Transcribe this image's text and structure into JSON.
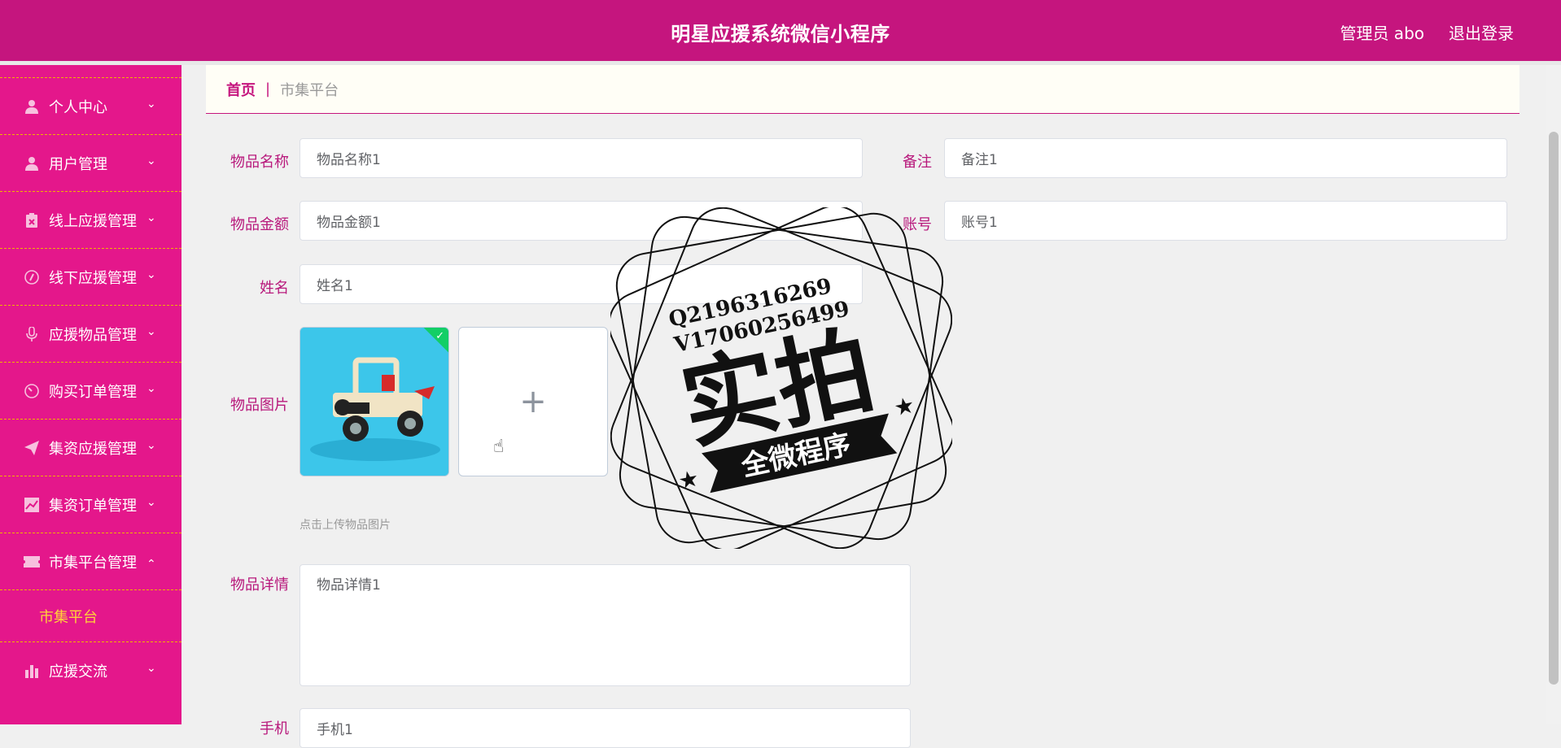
{
  "header": {
    "title": "明星应援系统微信小程序",
    "admin": "管理员 abo",
    "logout": "退出登录",
    "background": "#c5157e"
  },
  "sidebar": {
    "background": "#e4178b",
    "items": [
      {
        "label": "个人中心",
        "icon": "person-icon",
        "expanded": false
      },
      {
        "label": "用户管理",
        "icon": "person-icon",
        "expanded": false
      },
      {
        "label": "线上应援管理",
        "icon": "clipboard-icon",
        "expanded": false
      },
      {
        "label": "线下应援管理",
        "icon": "compass-icon",
        "expanded": false
      },
      {
        "label": "应援物品管理",
        "icon": "microphone-icon",
        "expanded": false
      },
      {
        "label": "购买订单管理",
        "icon": "gauge-icon",
        "expanded": false
      },
      {
        "label": "集资应援管理",
        "icon": "send-icon",
        "expanded": false
      },
      {
        "label": "集资订单管理",
        "icon": "chart-icon",
        "expanded": false
      },
      {
        "label": "市集平台管理",
        "icon": "ticket-icon",
        "expanded": true
      },
      {
        "label": "应援交流",
        "icon": "bar-chart-icon",
        "expanded": false
      }
    ],
    "submenu": {
      "label": "市集平台",
      "active_color": "#ffd23a"
    }
  },
  "breadcrumb": {
    "home": "首页",
    "separator": "|",
    "current": "市集平台"
  },
  "form": {
    "item_name": {
      "label": "物品名称",
      "value": "物品名称1"
    },
    "note": {
      "label": "备注",
      "value": "备注1"
    },
    "item_amount": {
      "label": "物品金额",
      "value": "物品金额1"
    },
    "account": {
      "label": "账号",
      "value": "账号1"
    },
    "name": {
      "label": "姓名",
      "value": "姓名1"
    },
    "image": {
      "label": "物品图片",
      "hint": "点击上传物品图片"
    },
    "detail": {
      "label": "物品详情",
      "value": "物品详情1"
    },
    "phone": {
      "label": "手机",
      "value": "手机1"
    }
  },
  "watermark": {
    "line1": "Q2196316269",
    "line2": "V17060256499",
    "main": "实拍",
    "banner": "全微程序"
  }
}
